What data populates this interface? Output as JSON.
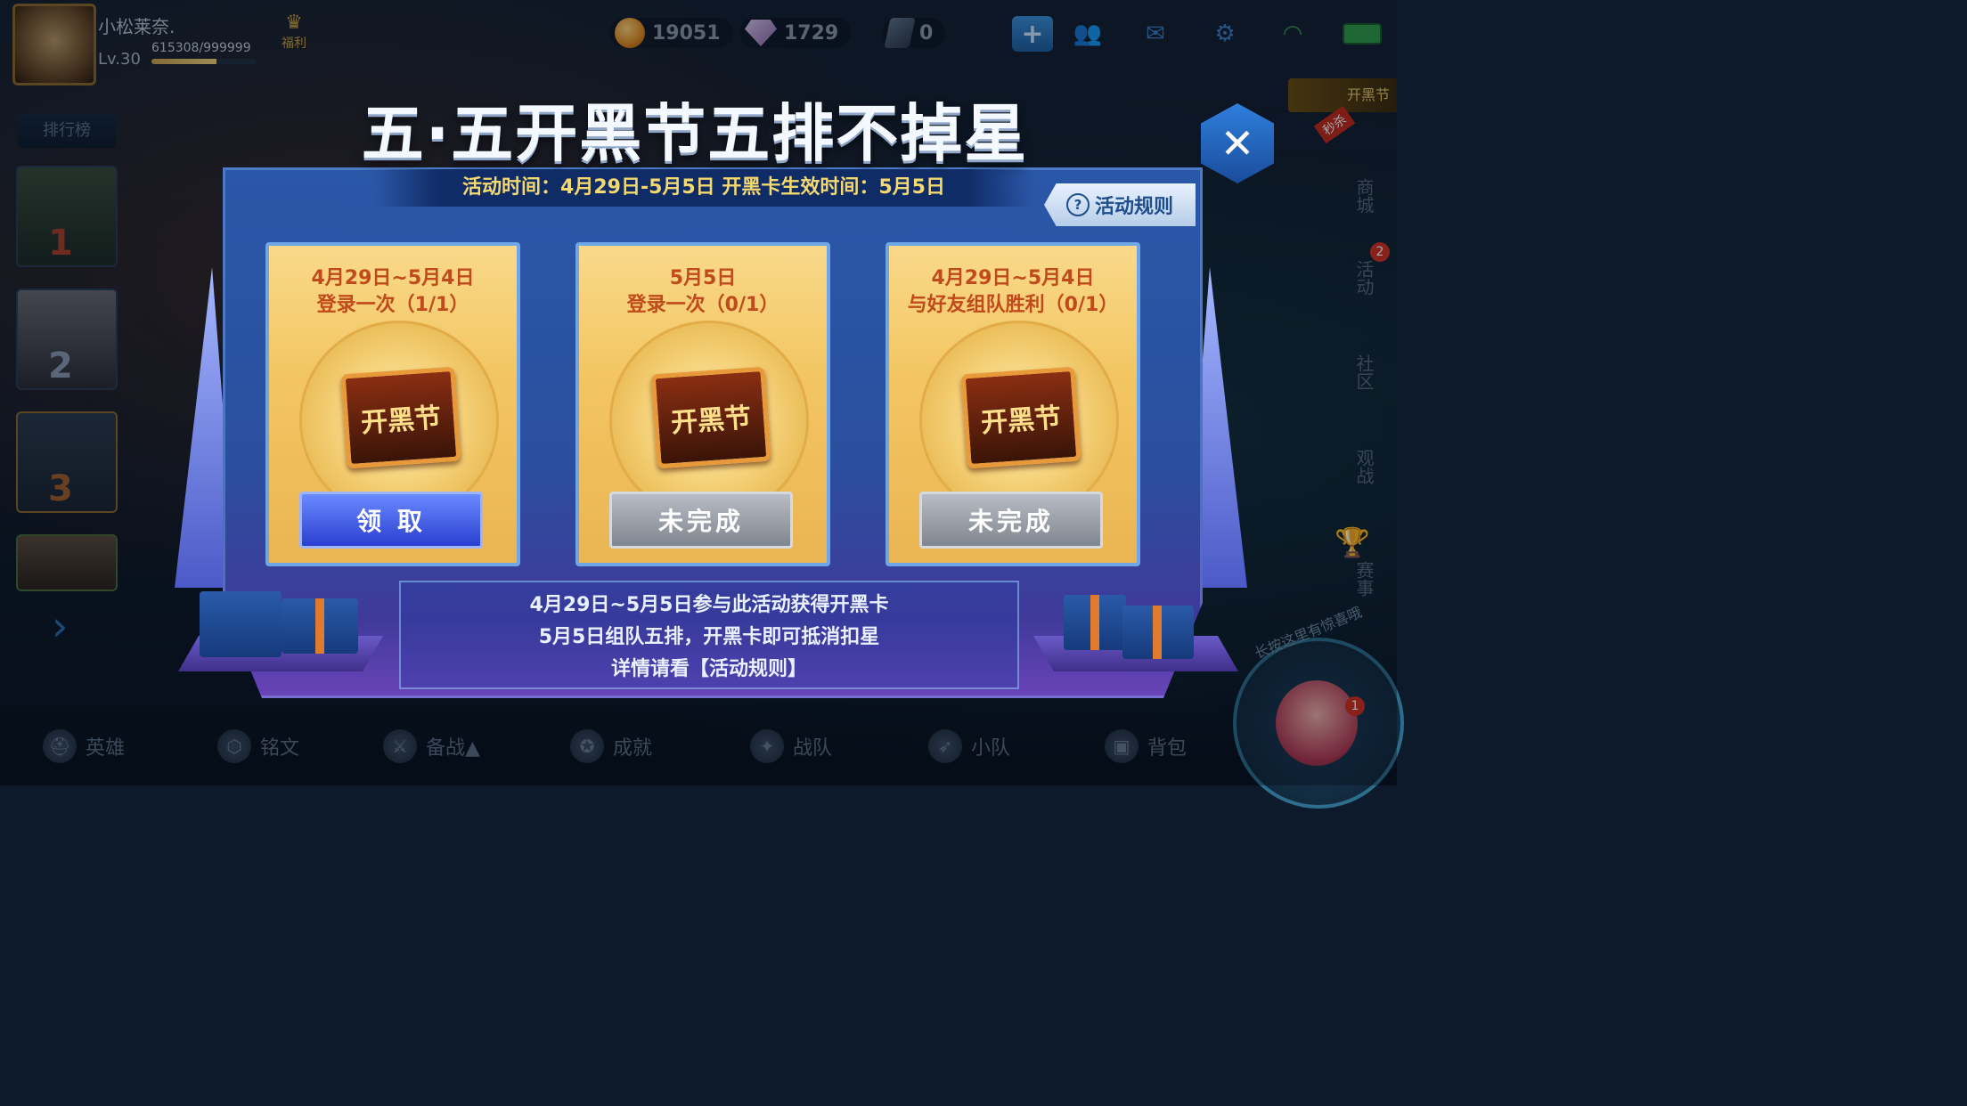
{
  "player": {
    "name": "小松莱奈.",
    "level": "Lv.30",
    "exp_text": "615308/999999",
    "exp_fraction": 0.615,
    "welfare_label": "福利"
  },
  "currency": {
    "gold": "19051",
    "diamond": "1729",
    "voucher": "0"
  },
  "top_icons": [
    "plus-icon",
    "friends-icon",
    "mail-icon",
    "settings-icon",
    "wifi-icon",
    "battery-icon"
  ],
  "sidebar_left": {
    "title": "排行榜",
    "ranks": [
      "1",
      "2",
      "3"
    ]
  },
  "sidebar_right": {
    "kaihei_tag": "开黑节",
    "kaihei_badge": "秒杀",
    "shop": "商城",
    "activity": "活动",
    "activity_badge": "2",
    "community": "社区",
    "watch": "观战",
    "events": "赛事"
  },
  "modal": {
    "title": "五·五开黑节五排不掉星",
    "time_info": "活动时间：4月29日-5月5日  开黑卡生效时间：5月5日",
    "rules_label": "活动规则",
    "medal_text": "开黑节",
    "cards": [
      {
        "date": "4月29日~5月4日",
        "task": "登录一次（1/1）",
        "button": "领 取",
        "state": "claim"
      },
      {
        "date": "5月5日",
        "task": "登录一次（0/1）",
        "button": "未完成",
        "state": "incomplete"
      },
      {
        "date": "4月29日~5月4日",
        "task": "与好友组队胜利（0/1）",
        "button": "未完成",
        "state": "incomplete"
      }
    ],
    "info_lines": [
      "4月29日~5月5日参与此活动获得开黑卡",
      "5月5日组队五排，开黑卡即可抵消扣星",
      "详情请看【活动规则】"
    ]
  },
  "bottom_nav": [
    {
      "label": "英雄",
      "icon": "helmet-icon"
    },
    {
      "label": "铭文",
      "icon": "rune-icon"
    },
    {
      "label": "备战▲",
      "icon": "sword-icon"
    },
    {
      "label": "成就",
      "icon": "achievement-icon"
    },
    {
      "label": "战队",
      "icon": "dragon-icon"
    },
    {
      "label": "小队",
      "icon": "wing-icon"
    },
    {
      "label": "背包",
      "icon": "backpack-icon"
    }
  ],
  "helper": {
    "text": "长按这里有惊喜哦",
    "badge": "1"
  },
  "colors": {
    "accent_blue": "#2f7fdc",
    "card_gold": "#f3c663",
    "claim_button": "#2a3fd0",
    "incomplete_button": "#80868f",
    "task_text": "#c04a1c",
    "time_text": "#f4d870"
  }
}
